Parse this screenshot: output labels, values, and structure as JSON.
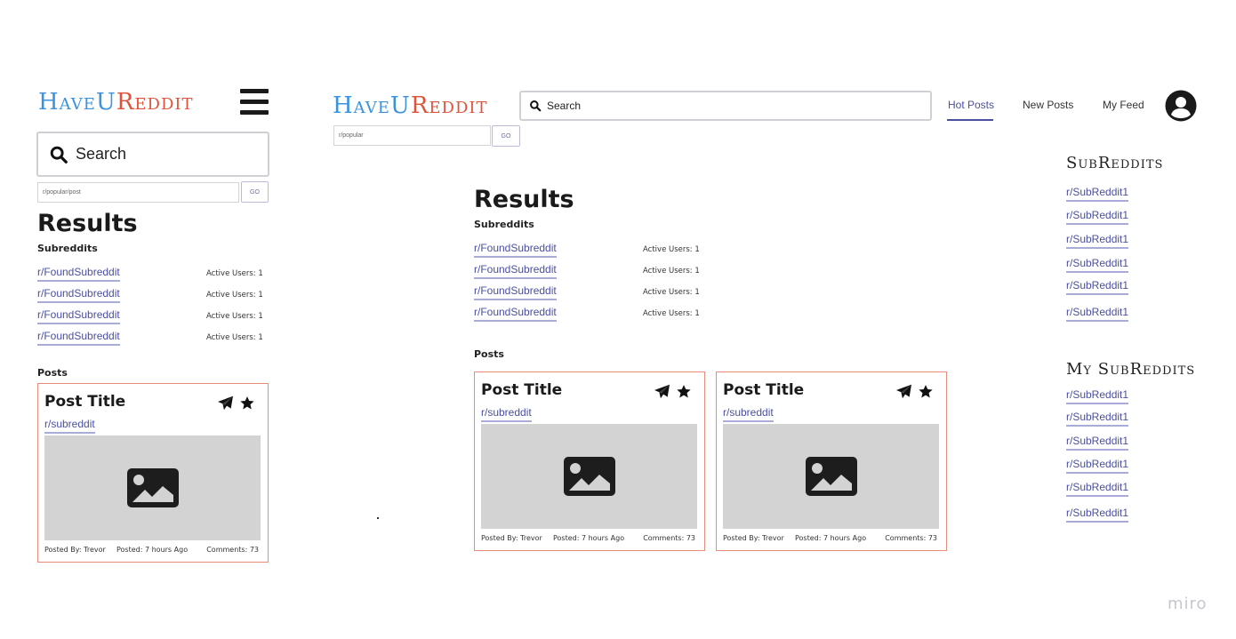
{
  "brand": {
    "part1": "HaveU",
    "part2": "Reddit",
    "colors": {
      "blue": "#3a93dc",
      "red": "#e0533a"
    }
  },
  "mobile": {
    "search_placeholder": "Search",
    "path_value": "r/popular/post",
    "go_label": "GO",
    "results_title": "Results",
    "subreddits_label": "Subreddits",
    "subreddits": [
      {
        "name": "r/FoundSubreddit",
        "active": "Active Users: 1"
      },
      {
        "name": "r/FoundSubreddit",
        "active": "Active Users: 1"
      },
      {
        "name": "r/FoundSubreddit",
        "active": "Active Users: 1"
      },
      {
        "name": "r/FoundSubreddit",
        "active": "Active Users: 1"
      }
    ],
    "posts_label": "Posts",
    "posts": [
      {
        "title": "Post Title",
        "subreddit": "r/subreddit",
        "posted_by": "Posted By: Trevor",
        "posted": "Posted: 7 hours Ago",
        "comments": "Comments: 73"
      }
    ]
  },
  "desktop": {
    "search_placeholder": "Search",
    "path_value": "r/popular",
    "go_label": "GO",
    "nav": [
      {
        "label": "Hot Posts",
        "active": true
      },
      {
        "label": "New Posts",
        "active": false
      },
      {
        "label": "My Feed",
        "active": false
      }
    ],
    "results_title": "Results",
    "subreddits_label": "Subreddits",
    "subreddits": [
      {
        "name": "r/FoundSubreddit",
        "active": "Active Users: 1"
      },
      {
        "name": "r/FoundSubreddit",
        "active": "Active Users: 1"
      },
      {
        "name": "r/FoundSubreddit",
        "active": "Active Users: 1"
      },
      {
        "name": "r/FoundSubreddit",
        "active": "Active Users: 1"
      }
    ],
    "posts_label": "Posts",
    "posts": [
      {
        "title": "Post Title",
        "subreddit": "r/subreddit",
        "posted_by": "Posted By: Trevor",
        "posted": "Posted: 7 hours Ago",
        "comments": "Comments: 73"
      },
      {
        "title": "Post Title",
        "subreddit": "r/subreddit",
        "posted_by": "Posted By: Trevor",
        "posted": "Posted: 7 hours Ago",
        "comments": "Comments: 73"
      }
    ],
    "sidebar": {
      "subreddits_title": "SubReddits",
      "subreddits": [
        "r/SubReddit1",
        "r/SubReddit1",
        "r/SubReddit1",
        "r/SubReddit1",
        "r/SubReddit1",
        "r/SubReddit1"
      ],
      "my_subreddits_title": "My SubReddits",
      "my_subreddits": [
        "r/SubReddit1",
        "r/SubReddit1",
        "r/SubReddit1",
        "r/SubReddit1",
        "r/SubReddit1",
        "r/SubReddit1"
      ]
    }
  },
  "watermark": "miro"
}
